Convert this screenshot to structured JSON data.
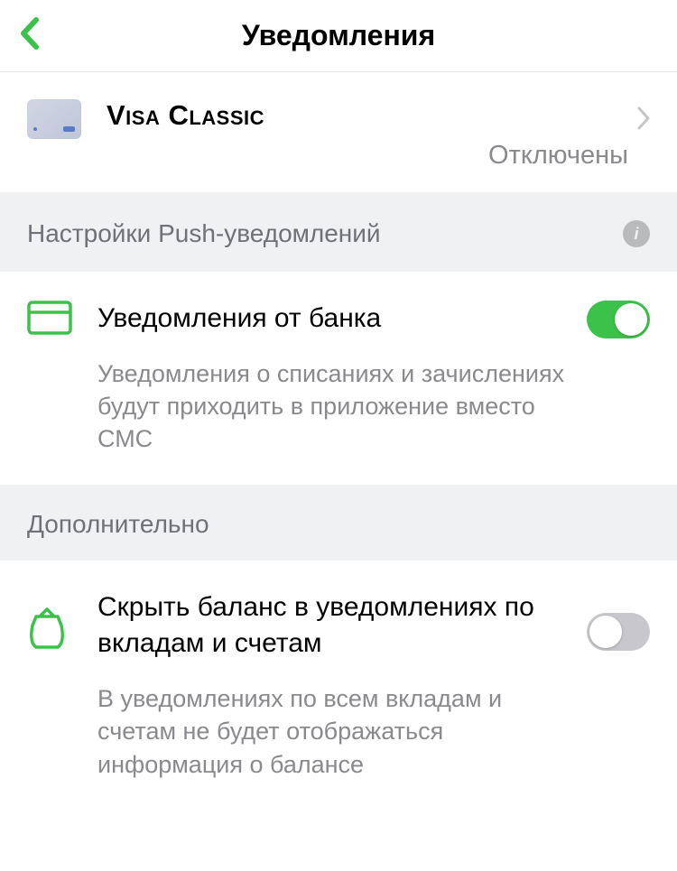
{
  "header": {
    "title": "Уведомления"
  },
  "card": {
    "name": "Visa Classic",
    "status": "Отключены"
  },
  "sections": {
    "push": {
      "header": "Настройки Push-уведомлений"
    },
    "additional": {
      "header": "Дополнительно"
    }
  },
  "settings": {
    "bank_notifications": {
      "title": "Уведомления от банка",
      "description": "Уведомления о списаниях и зачислениях будут приходить в приложение вместо СМС",
      "enabled": true
    },
    "hide_balance": {
      "title": "Скрыть баланс в уведомлениях по вкладам и счетам",
      "description": "В уведомлениях по всем вкладам и счетам не будет отображаться информация о балансе",
      "enabled": false
    }
  }
}
